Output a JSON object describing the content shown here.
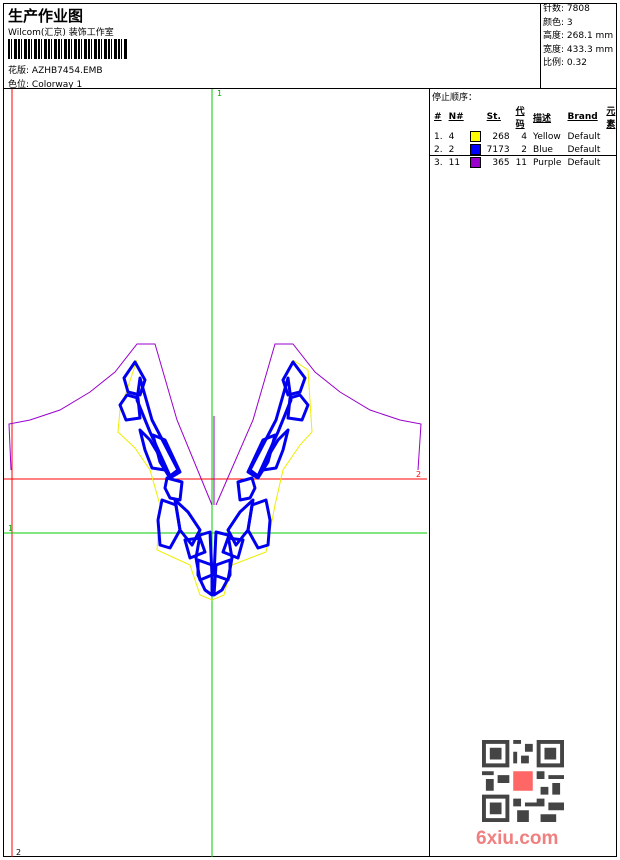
{
  "header": {
    "title": "生产作业图",
    "company": "Wilcom(汇京) 装饰工作室",
    "design_label": "花版:",
    "design_value": "AZHB7454.EMB",
    "colorway_label": "色位:",
    "colorway_value": "Colorway 1",
    "stats": [
      {
        "label": "针数:",
        "value": "7808"
      },
      {
        "label": "颜色:",
        "value": "3"
      },
      {
        "label": "高度:",
        "value": "268.1 mm"
      },
      {
        "label": "宽度:",
        "value": "433.3 mm"
      },
      {
        "label": "比例:",
        "value": "0.32"
      }
    ]
  },
  "stop_sequence": {
    "title": "停止顺序：",
    "columns": [
      "#",
      "N#",
      "St.",
      "代码",
      "描述",
      "Brand",
      "元素"
    ],
    "rows": [
      {
        "idx": "1.",
        "n": "4",
        "color": "#ffff00",
        "st": "268",
        "code": "4",
        "desc": "Yellow",
        "brand": "Default"
      },
      {
        "idx": "2.",
        "n": "2",
        "color": "#0000ff",
        "st": "7173",
        "code": "2",
        "desc": "Blue",
        "brand": "Default"
      },
      {
        "idx": "3.",
        "n": "11",
        "color": "#9900cc",
        "st": "365",
        "code": "11",
        "desc": "Purple",
        "brand": "Default"
      }
    ]
  },
  "canvas": {
    "guide_top": "1",
    "guide_left": "1",
    "guide_right": "2",
    "guide_bottom": "2"
  },
  "watermark": {
    "site": "6xiu.com"
  }
}
